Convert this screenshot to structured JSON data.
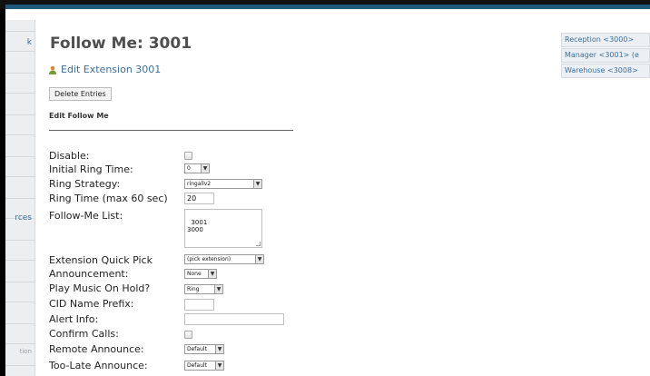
{
  "sidebar": {
    "fragments": [
      "k",
      "rces",
      "tion"
    ]
  },
  "page": {
    "title": "Follow Me: 3001",
    "edit_link": "Edit Extension 3001",
    "delete_button": "Delete Entries",
    "section_heading": "Edit Follow Me"
  },
  "form": {
    "disable_label": "Disable:",
    "initial_ring_time_label": "Initial Ring Time:",
    "initial_ring_time_value": "0",
    "ring_strategy_label": "Ring Strategy:",
    "ring_strategy_value": "ringallv2",
    "ring_time_label": "Ring Time (max 60 sec)",
    "ring_time_value": "20",
    "followme_list_label": "Follow-Me List:",
    "followme_list_value": "3001\n3000",
    "quick_pick_label": "Extension Quick Pick",
    "quick_pick_value": "(pick extension)",
    "announcement_label": "Announcement:",
    "announcement_value": "None",
    "music_on_hold_label": "Play Music On Hold?",
    "music_on_hold_value": "Ring",
    "cid_prefix_label": "CID Name Prefix:",
    "cid_prefix_value": "",
    "alert_info_label": "Alert Info:",
    "alert_info_value": "",
    "confirm_calls_label": "Confirm Calls:",
    "remote_announce_label": "Remote Announce:",
    "remote_announce_value": "Default",
    "too_late_announce_label": "Too-Late Announce:",
    "too_late_announce_value": "Default"
  },
  "extensions": [
    "Reception <3000>",
    "Manager <3001> (e",
    "Warehouse <3008>"
  ],
  "colors": {
    "link": "#3a6f9c",
    "title": "#4f4f4f",
    "top_bar": "#1f5a7a"
  }
}
